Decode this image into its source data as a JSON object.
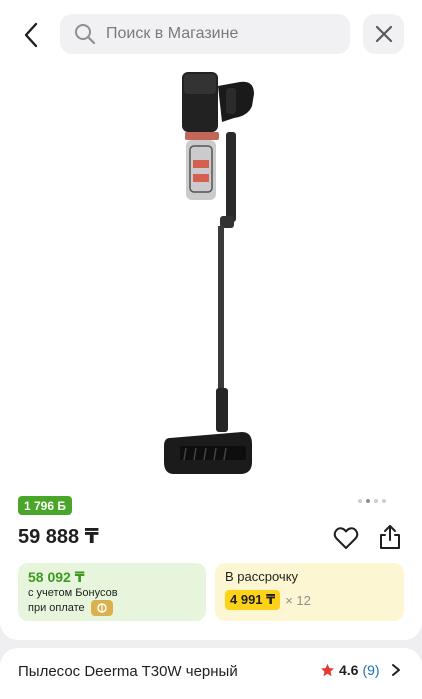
{
  "search": {
    "placeholder": "Поиск в Магазине"
  },
  "product": {
    "bonus_badge": "1 796 Б",
    "price": "59 888 ₸",
    "image_dots": {
      "count": 4,
      "active_index": 1
    },
    "bonus_offer": {
      "price": "58 092 ₸",
      "line1": "с учетом Бонусов",
      "line2": "при оплате"
    },
    "installment": {
      "title": "В рассрочку",
      "amount": "4 991 ₸",
      "multiplier": "× 12"
    },
    "name": "Пылесос Deerma T30W черный",
    "rating": "4.6",
    "reviews": "(9)"
  },
  "colors": {
    "bonus_green": "#4aa628",
    "bonus_bg": "#e6f5dc",
    "install_bg": "#fdf6d2",
    "install_yellow": "#ffd21a",
    "rating_star": "#e53935",
    "link_blue": "#1a6fb5"
  },
  "icons": {
    "back": "chevron-left-icon",
    "search": "search-icon",
    "close": "close-icon",
    "favorite": "heart-icon",
    "share": "share-icon",
    "rating": "star-icon",
    "chevron": "chevron-right-icon",
    "bonus_coin": "coin-icon"
  }
}
